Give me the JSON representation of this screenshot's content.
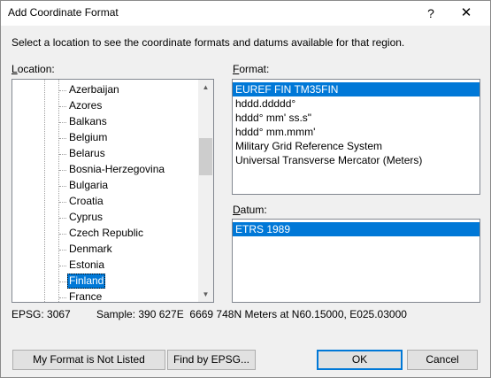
{
  "window": {
    "title": "Add Coordinate Format",
    "help_glyph": "?",
    "close_glyph": "✕"
  },
  "instruction": "Select a location to see the coordinate formats and datums available for that region.",
  "location": {
    "label_underlined": "L",
    "label_rest": "ocation:",
    "items": [
      "Azerbaijan",
      "Azores",
      "Balkans",
      "Belgium",
      "Belarus",
      "Bosnia-Herzegovina",
      "Bulgaria",
      "Croatia",
      "Cyprus",
      "Czech Republic",
      "Denmark",
      "Estonia",
      "Finland",
      "France"
    ],
    "selected": "Finland",
    "scroll_fraction": 0.28
  },
  "format": {
    "label_underlined": "F",
    "label_rest": "ormat:",
    "items": [
      "EUREF FIN TM35FIN",
      "hddd.ddddd°",
      "hddd° mm' ss.s\"",
      "hddd° mm.mmm'",
      "Military Grid Reference System",
      "Universal Transverse Mercator (Meters)"
    ],
    "selected": "EUREF FIN TM35FIN"
  },
  "datum": {
    "label_underlined": "D",
    "label_rest": "atum:",
    "items": [
      "ETRS 1989"
    ],
    "selected": "ETRS 1989"
  },
  "status": {
    "epsg": "EPSG: 3067",
    "sample": "Sample: 390 627E  6669 748N Meters at N60.15000, E025.03000"
  },
  "buttons": {
    "not_listed": "My Format is Not Listed",
    "find_epsg": "Find by EPSG...",
    "ok": "OK",
    "cancel": "Cancel"
  },
  "colors": {
    "selection": "#0078d7",
    "dialog_bg": "#f0f0f0"
  }
}
